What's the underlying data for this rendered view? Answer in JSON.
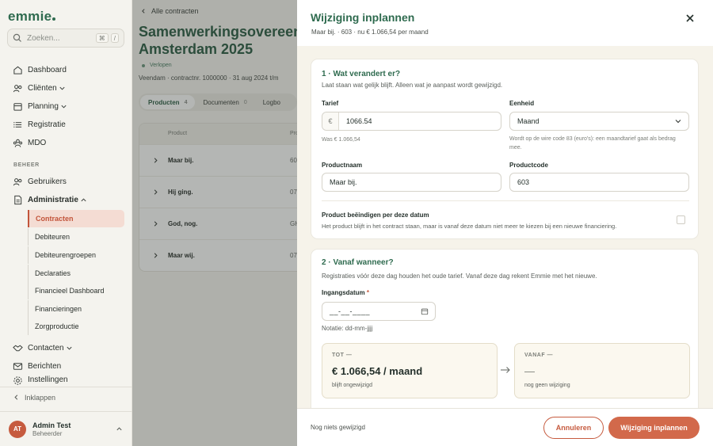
{
  "sidebar": {
    "logo": "emmie",
    "search_placeholder": "Zoeken...",
    "kbd1": "⌘",
    "kbd2": "/",
    "items": [
      {
        "label": "Dashboard"
      },
      {
        "label": "Cliënten"
      },
      {
        "label": "Planning"
      },
      {
        "label": "Registratie"
      },
      {
        "label": "MDO"
      }
    ],
    "section_beheer": "BEHEER",
    "beheer_items": [
      {
        "label": "Gebruikers"
      },
      {
        "label": "Administratie"
      }
    ],
    "sub_items": [
      {
        "label": "Contracten"
      },
      {
        "label": "Debiteuren"
      },
      {
        "label": "Debiteurengroepen"
      },
      {
        "label": "Declaraties"
      },
      {
        "label": "Financieel Dashboard"
      },
      {
        "label": "Financieringen"
      },
      {
        "label": "Zorgproductie"
      }
    ],
    "after_items": [
      {
        "label": "Contacten"
      },
      {
        "label": "Berichten"
      },
      {
        "label": "Instellingen"
      }
    ],
    "collapse_label": "Inklappen",
    "user": {
      "initials": "AT",
      "name": "Admin Test",
      "role": "Beheerder"
    }
  },
  "main": {
    "back_label": "Alle contracten",
    "title_line1": "Samenwerkingsovereen",
    "title_line2": "Amsterdam 2025",
    "status": "Verlopen",
    "meta": "Veendam · contractnr. 1000000 · 31 aug 2024 t/m",
    "tabs": [
      {
        "label": "Producten",
        "count": "4"
      },
      {
        "label": "Documenten",
        "count": "0"
      },
      {
        "label": "Logbo"
      }
    ],
    "table": {
      "headers": [
        "Product",
        "Pro"
      ],
      "rows": [
        {
          "name": "Maar bij.",
          "code": "60"
        },
        {
          "name": "Hij ging.",
          "code": "07"
        },
        {
          "name": "God, nog.",
          "code": "GH"
        },
        {
          "name": "Maar wij.",
          "code": "07"
        }
      ]
    }
  },
  "drawer": {
    "title": "Wijziging inplannen",
    "subtitle": "Maar bij. · 603 · nu € 1.066,54 per maand",
    "section1": {
      "title": "1 · Wat verandert er?",
      "desc": "Laat staan wat gelijk blijft. Alleen wat je aanpast wordt gewijzigd.",
      "tarief_label": "Tarief",
      "tarief_prefix": "€",
      "tarief_value": "1066.54",
      "tarief_hint": "Was € 1.066,54",
      "eenheid_label": "Eenheid",
      "eenheid_value": "Maand",
      "eenheid_hint": "Wordt op de wire code 83 (euro's): een maandtarief gaat als bedrag mee.",
      "productnaam_label": "Productnaam",
      "productnaam_value": "Maar bij.",
      "productcode_label": "Productcode",
      "productcode_value": "603",
      "end_label": "Product beëindigen per deze datum",
      "end_desc": "Het product blijft in het contract staan, maar is vanaf deze datum niet meer te kiezen bij een nieuwe financiering."
    },
    "section2": {
      "title": "2 · Vanaf wanneer?",
      "desc": "Registraties vóór deze dag houden het oude tarief. Vanaf deze dag rekent Emmie met het nieuwe.",
      "date_label": "Ingangsdatum",
      "required_mark": "*",
      "date_value": "__-__-____",
      "date_hint": "Notatie: dd-mm-jjjj",
      "tot_label": "TOT —",
      "tot_value": "€ 1.066,54 / maand",
      "tot_small": "blijft ongewijzigd",
      "vanaf_label": "VANAF —",
      "vanaf_value": "—",
      "vanaf_small": "nog geen wijziging"
    },
    "footer": {
      "status": "Nog niets gewijzigd",
      "cancel": "Annuleren",
      "submit": "Wijziging inplannen"
    }
  }
}
